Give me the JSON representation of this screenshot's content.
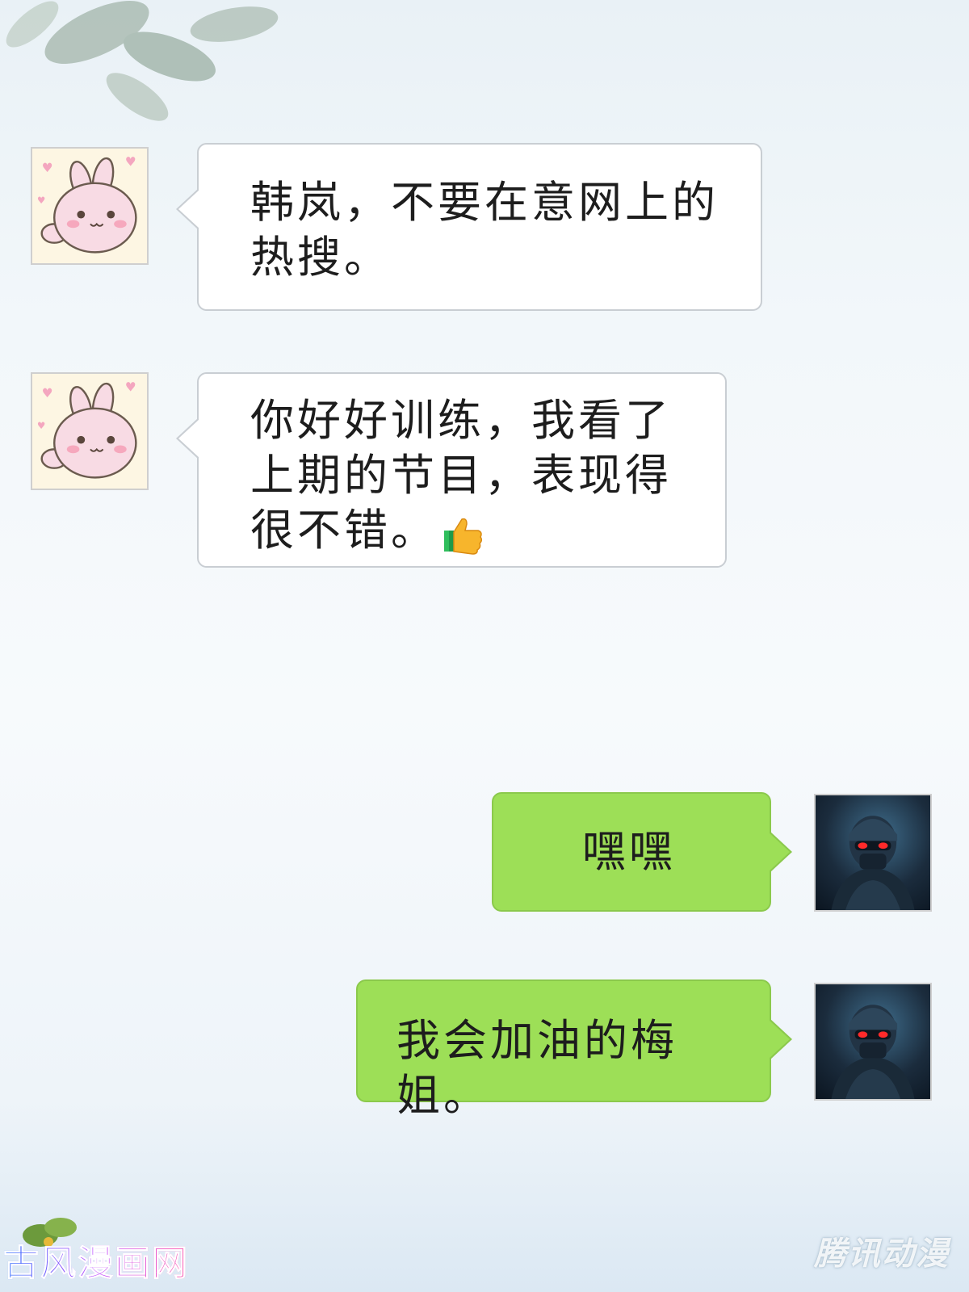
{
  "messages": [
    {
      "side": "in",
      "sender": "bunny",
      "text": "韩岚，不要在意网上的\n热搜。"
    },
    {
      "side": "in",
      "sender": "bunny",
      "text": "你好好训练，我看了\n上期的节目，表现得\n很不错。",
      "emoji": "thumbs-up-icon"
    },
    {
      "side": "out",
      "sender": "soldier",
      "text": "嘿嘿"
    },
    {
      "side": "out",
      "sender": "soldier",
      "text": "我会加油的梅姐。"
    }
  ],
  "watermarks": {
    "left": "古风漫画网",
    "right": "腾讯动漫"
  },
  "colors": {
    "incoming_bubble": "#ffffff",
    "outgoing_bubble": "#9ddf57",
    "text": "#1d1d1d"
  }
}
